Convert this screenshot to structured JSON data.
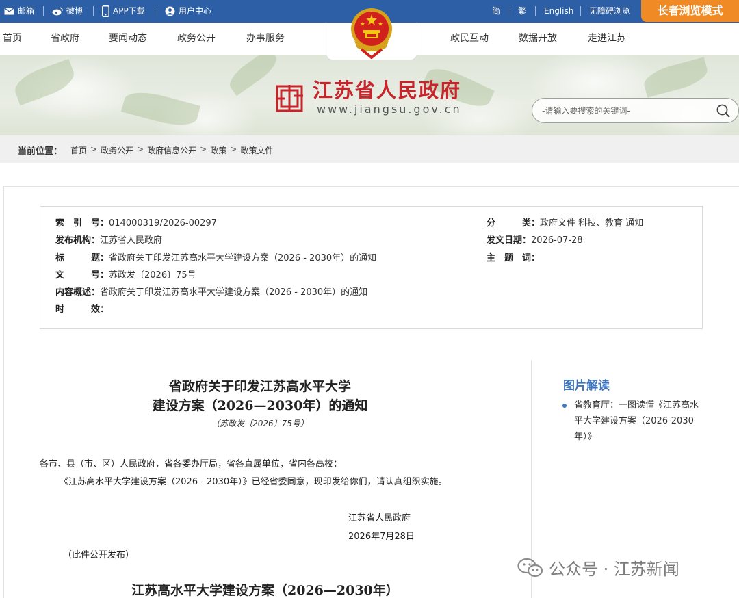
{
  "topbar": {
    "mail": "邮箱",
    "weibo": "微博",
    "app": "APP下载",
    "user": "用户中心",
    "simplified": "简",
    "traditional": "繁",
    "english": "English",
    "accessible": "无障碍浏览",
    "elder_mode": "长者浏览模式"
  },
  "nav": {
    "items": [
      "首页",
      "省政府",
      "要闻动态",
      "政务公开",
      "办事服务",
      "政民互动",
      "数据开放",
      "走进江苏"
    ]
  },
  "site": {
    "name": "江苏省人民政府",
    "url": "www.jiangsu.gov.cn"
  },
  "search": {
    "placeholder": "-请输入要搜索的关键词-"
  },
  "breadcrumb": {
    "label": "当前位置：",
    "trail": [
      "首页",
      "政务公开",
      "政府信息公开",
      "政策",
      "政策文件"
    ]
  },
  "meta": {
    "index_key": "索　引　号：",
    "index_val": "014000319/2026-00297",
    "org_key": "发布机构：",
    "org_val": "江苏省人民政府",
    "title_key": "标　　　题：",
    "title_val": "省政府关于印发江苏高水平大学建设方案（2026 - 2030年）的通知",
    "docno_key": "文　　　号：",
    "docno_val": "苏政发〔2026〕75号",
    "summary_key": "内容概述：",
    "summary_val": "省政府关于印发江苏高水平大学建设方案（2026 - 2030年）的通知",
    "validity_key": "时　　　效：",
    "validity_val": "",
    "category_key": "分　　　类：",
    "category_val": "政府文件 科技、教育 通知",
    "date_key": "发文日期：",
    "date_val": "2026-07-28",
    "subject_key": "主　题　词：",
    "subject_val": ""
  },
  "doc": {
    "title_line1": "省政府关于印发江苏高水平大学",
    "title_line2": "建设方案（2026—2030年）的通知",
    "number": "（苏政发〔2026〕75号）",
    "salutation": "各市、县（市、区）人民政府，省各委办厅局，省各直属单位，省内各高校：",
    "paragraph": "《江苏高水平大学建设方案（2026 - 2030年）》已经省委同意，现印发给你们，请认真组织实施。",
    "signer": "江苏省人民政府",
    "sign_date": "2026年7月28日",
    "publish_note": "（此件公开发布）",
    "attachment_title": "江苏高水平大学建设方案（2026—2030年）"
  },
  "sidebar": {
    "title": "图片解读",
    "items": [
      {
        "label": "省教育厅：一图读懂《江苏高水平大学建设方案（2026-2030年）》"
      }
    ]
  },
  "watermark": {
    "text": "公众号 · 江苏新闻"
  },
  "colors": {
    "topbar_bg": "#2c5fa5",
    "elder_btn": "#f08a24",
    "brand_red": "#c8242b",
    "link_blue": "#3b73bd"
  }
}
